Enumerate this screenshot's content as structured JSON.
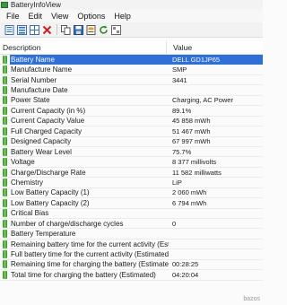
{
  "window": {
    "title": "BatteryInfoView"
  },
  "menu": [
    "File",
    "Edit",
    "View",
    "Options",
    "Help"
  ],
  "toolbar": [
    "properties-icon",
    "list-view-icon",
    "grid-view-icon",
    "delete-icon",
    "copy-icon",
    "save-icon",
    "html-report-icon",
    "refresh-icon",
    "about-icon"
  ],
  "columns": {
    "description": "Description",
    "value": "Value"
  },
  "rows": [
    {
      "label": "Battery Name",
      "value": "DELL GD1JP65",
      "selected": true
    },
    {
      "label": "Manufacture Name",
      "value": "SMP"
    },
    {
      "label": "Serial Number",
      "value": "3441"
    },
    {
      "label": "Manufacture Date",
      "value": ""
    },
    {
      "label": "Power State",
      "value": "Charging, AC Power"
    },
    {
      "label": "Current Capacity (in %)",
      "value": "89.1%"
    },
    {
      "label": "Current Capacity Value",
      "value": "45 858 mWh"
    },
    {
      "label": "Full Charged Capacity",
      "value": "51 467 mWh"
    },
    {
      "label": "Designed Capacity",
      "value": "67 997 mWh"
    },
    {
      "label": "Battery Wear Level",
      "value": "75.7%"
    },
    {
      "label": "Voltage",
      "value": "8 377 millivolts"
    },
    {
      "label": "Charge/Discharge Rate",
      "value": "11 582 milliwatts"
    },
    {
      "label": "Chemistry",
      "value": "LiP"
    },
    {
      "label": "Low Battery Capacity (1)",
      "value": "2 060 mWh"
    },
    {
      "label": "Low Battery Capacity (2)",
      "value": "6 794 mWh"
    },
    {
      "label": "Critical Bias",
      "value": ""
    },
    {
      "label": "Number of charge/discharge cycles",
      "value": "0"
    },
    {
      "label": "Battery Temperature",
      "value": ""
    },
    {
      "label": "Remaining battery time for the current activity (Est...",
      "value": ""
    },
    {
      "label": "Full battery time for the current activity (Estimated)",
      "value": ""
    },
    {
      "label": "Remaining time for charging the battery (Estimated)",
      "value": "00:28:25"
    },
    {
      "label": "Total  time for charging the battery (Estimated)",
      "value": "04:20:04"
    }
  ],
  "watermark": "bazos"
}
